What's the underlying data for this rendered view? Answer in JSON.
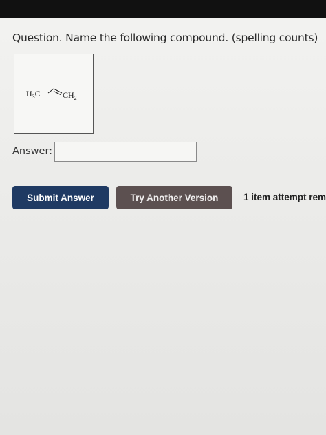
{
  "question": {
    "text": "Question. Name the following compound. (spelling counts)"
  },
  "structure": {
    "left_group": "H",
    "left_sub": "3",
    "left_atom": "C",
    "right_group": "CH",
    "right_sub": "2"
  },
  "answer": {
    "label": "Answer:",
    "value": ""
  },
  "buttons": {
    "submit_label": "Submit Answer",
    "try_label": "Try Another Version"
  },
  "status": {
    "attempts_text": "1 item attempt rem"
  },
  "colors": {
    "submit_bg": "#1f3a63",
    "try_bg": "#5c5050",
    "top_bar": "#111111"
  }
}
